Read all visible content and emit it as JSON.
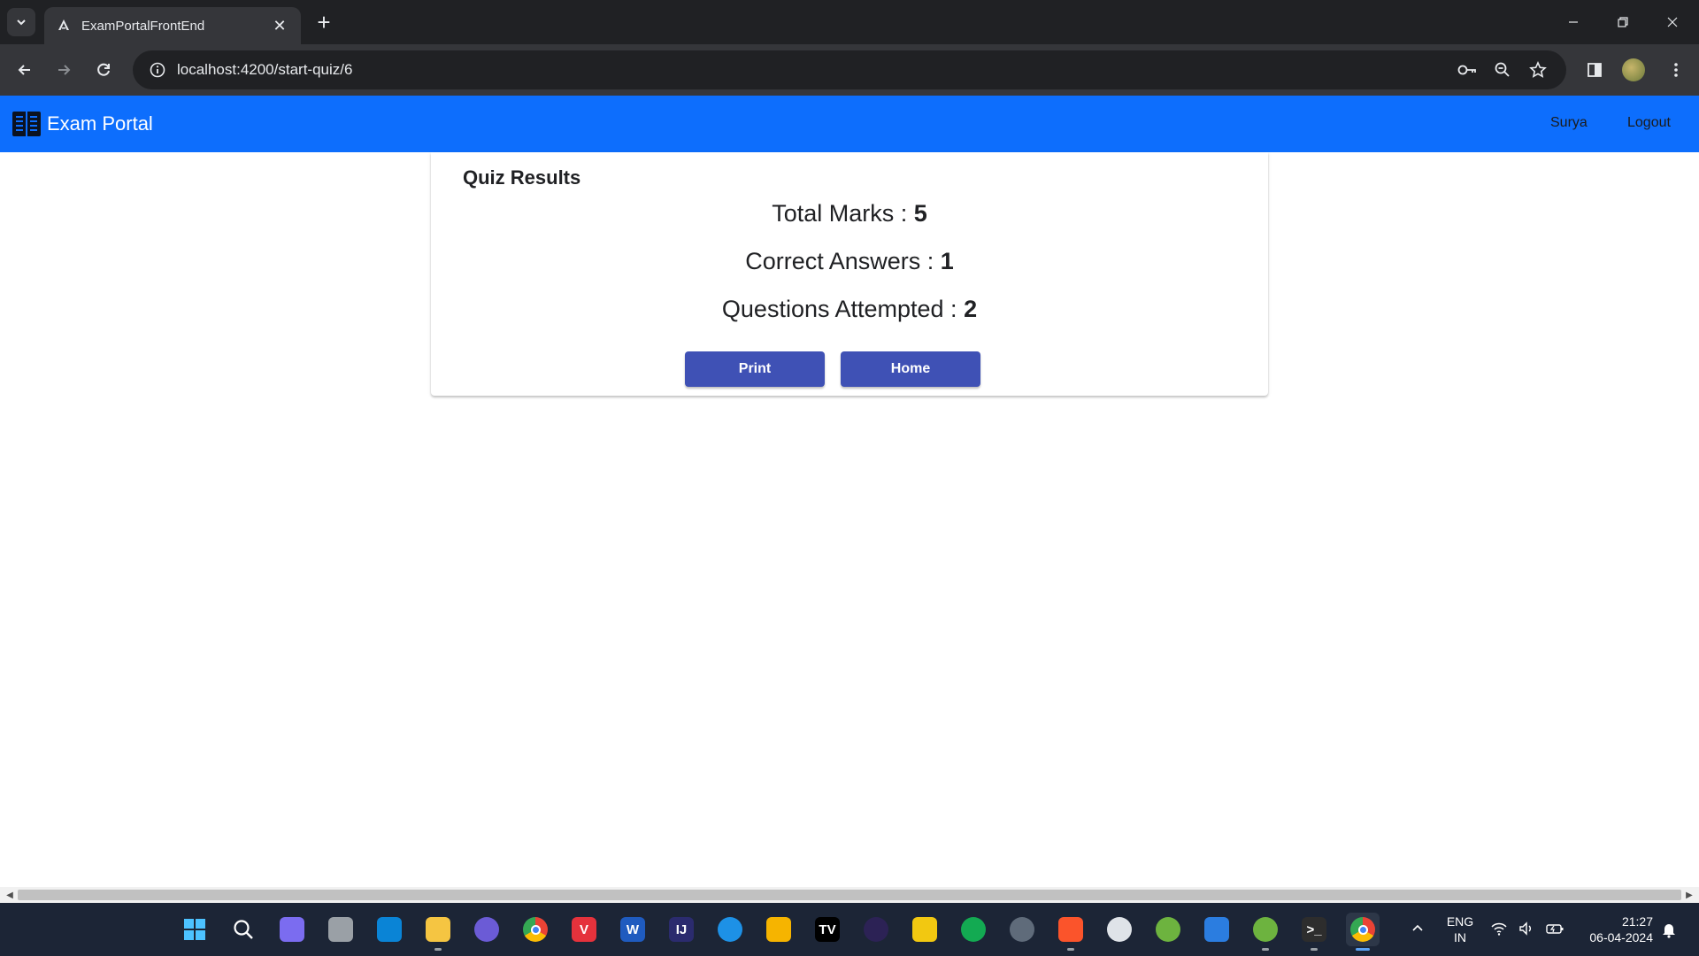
{
  "browser": {
    "tab_title": "ExamPortalFrontEnd",
    "url": "localhost:4200/start-quiz/6"
  },
  "app": {
    "brand": "Exam Portal",
    "nav": {
      "user": "Surya",
      "logout": "Logout"
    }
  },
  "results": {
    "title": "Quiz Results",
    "total_marks_label": "Total Marks : ",
    "total_marks_value": "5",
    "correct_answers_label": "Correct Answers : ",
    "correct_answers_value": "1",
    "questions_attempted_label": "Questions Attempted : ",
    "questions_attempted_value": "2",
    "print_button": "Print",
    "home_button": "Home"
  },
  "taskbar": {
    "apps": [
      {
        "name": "start",
        "icon": "windows-icon",
        "color": "#4cc2ff",
        "glyph": "",
        "running": false
      },
      {
        "name": "search",
        "icon": "search-icon",
        "color": "transparent",
        "glyph": "",
        "running": false
      },
      {
        "name": "copilot",
        "icon": "copilot-icon",
        "color": "#7b6cf0",
        "glyph": "",
        "running": false
      },
      {
        "name": "task-view",
        "icon": "task-view-icon",
        "color": "#9aa0a6",
        "glyph": "",
        "running": false
      },
      {
        "name": "vscode",
        "icon": "vscode-icon",
        "color": "#0a84d6",
        "glyph": "",
        "running": false
      },
      {
        "name": "file-explorer",
        "icon": "folder-icon",
        "color": "#f5c542",
        "glyph": "",
        "running": true
      },
      {
        "name": "app-purple",
        "icon": "circle-app-icon",
        "color": "#6b5bd6",
        "glyph": "",
        "running": false
      },
      {
        "name": "chrome-1",
        "icon": "chrome-icon",
        "color": "#34a853",
        "glyph": "",
        "running": false
      },
      {
        "name": "vivaldi",
        "icon": "vivaldi-icon",
        "color": "#e5323c",
        "glyph": "V",
        "running": false
      },
      {
        "name": "word",
        "icon": "word-icon",
        "color": "#1f5bbf",
        "glyph": "W",
        "running": false
      },
      {
        "name": "intellij",
        "icon": "intellij-icon",
        "color": "#2b2b6e",
        "glyph": "IJ",
        "running": false
      },
      {
        "name": "docker",
        "icon": "docker-icon",
        "color": "#1d91e6",
        "glyph": "",
        "running": false
      },
      {
        "name": "keep",
        "icon": "notes-icon",
        "color": "#f6b400",
        "glyph": "",
        "running": false
      },
      {
        "name": "tradingview",
        "icon": "tradingview-icon",
        "color": "#000000",
        "glyph": "TV",
        "running": false
      },
      {
        "name": "eclipse",
        "icon": "eclipse-icon",
        "color": "#2c2255",
        "glyph": "",
        "running": false
      },
      {
        "name": "power-bi",
        "icon": "power-bi-icon",
        "color": "#f2c811",
        "glyph": "",
        "running": false
      },
      {
        "name": "mongodb",
        "icon": "mongodb-icon",
        "color": "#13aa52",
        "glyph": "",
        "running": false
      },
      {
        "name": "settings",
        "icon": "gear-icon",
        "color": "#5f6b7a",
        "glyph": "",
        "running": false
      },
      {
        "name": "brave",
        "icon": "brave-icon",
        "color": "#fb542b",
        "glyph": "",
        "running": true
      },
      {
        "name": "clock",
        "icon": "clock-icon",
        "color": "#dfe3e8",
        "glyph": "",
        "running": false
      },
      {
        "name": "spring-1",
        "icon": "spring-icon",
        "color": "#6db33f",
        "glyph": "",
        "running": false
      },
      {
        "name": "remote",
        "icon": "remote-desktop-icon",
        "color": "#2b7de0",
        "glyph": "",
        "running": false
      },
      {
        "name": "spring-2",
        "icon": "spring-icon",
        "color": "#6db33f",
        "glyph": "",
        "running": true
      },
      {
        "name": "terminal",
        "icon": "terminal-icon",
        "color": "#2d2d2d",
        "glyph": ">_",
        "running": true
      },
      {
        "name": "chrome-2",
        "icon": "chrome-icon",
        "color": "#34a853",
        "glyph": "",
        "running": true,
        "active": true
      }
    ],
    "language_line1": "ENG",
    "language_line2": "IN",
    "time": "21:27",
    "date": "06-04-2024"
  }
}
